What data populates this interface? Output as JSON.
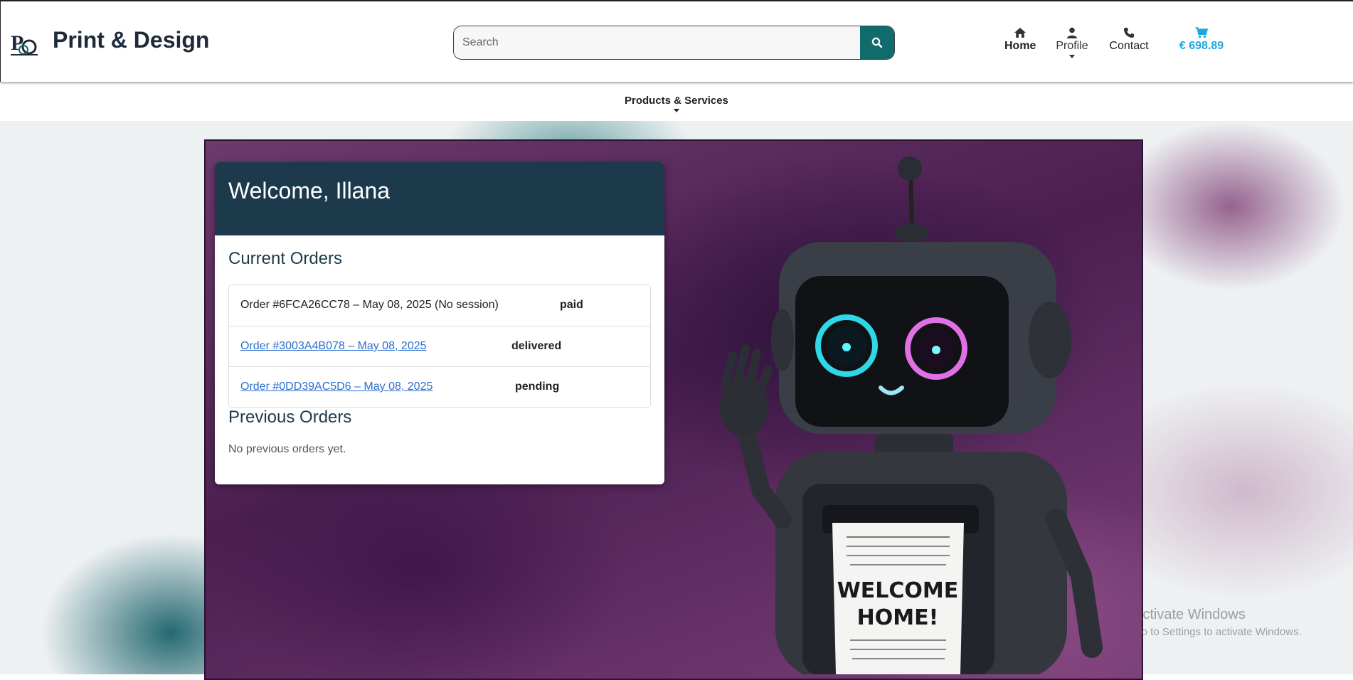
{
  "header": {
    "brand": "Print & Design",
    "search": {
      "placeholder": "Search"
    },
    "nav": {
      "home": "Home",
      "profile": "Profile",
      "contact": "Contact",
      "cart_total": "€ 698.89"
    }
  },
  "subnav": {
    "products": "Products & Services"
  },
  "dashboard": {
    "welcome": "Welcome, Illana",
    "current_orders_title": "Current Orders",
    "current_orders": [
      {
        "label": "Order #6FCA26CC78 – May 08, 2025 (No session)",
        "status": "paid",
        "link": false
      },
      {
        "label": "Order #3003A4B078 – May 08, 2025",
        "status": "delivered",
        "link": true
      },
      {
        "label": "Order #0DD39AC5D6 – May 08, 2025",
        "status": "pending",
        "link": true
      }
    ],
    "previous_orders_title": "Previous Orders",
    "previous_orders_empty": "No previous orders yet."
  },
  "hero": {
    "receipt_text": "WELCOME HOME!"
  },
  "watermark": {
    "line1": "Activate Windows",
    "line2": "Go to Settings to activate Windows."
  },
  "colors": {
    "accent": "#0f6b6c",
    "card_header": "#1d3a4c",
    "cart": "#1aa8e0",
    "link": "#2c6fd0"
  },
  "icons": [
    "logo-icon",
    "search-icon",
    "home-icon",
    "user-icon",
    "phone-icon",
    "cart-icon",
    "chevron-down-icon"
  ]
}
